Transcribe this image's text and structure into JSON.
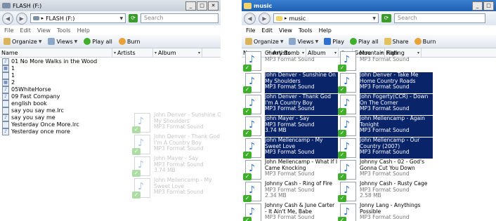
{
  "left": {
    "title": "FLASH (F:)",
    "address": "FLASH (F:)",
    "search_placeholder": "Search",
    "menu": [
      "File",
      "Edit",
      "View",
      "Tools",
      "Help"
    ],
    "toolbar": {
      "organize": "Organize",
      "views": "Views",
      "play_all": "Play all",
      "burn": "Burn"
    },
    "columns": [
      "Name",
      "Artists",
      "Album"
    ],
    "files": [
      {
        "name": "01 No More Walks in the Wood",
        "icon": "audio-file-icon"
      },
      {
        "name": "1",
        "icon": "image-file-icon"
      },
      {
        "name": "1",
        "icon": "file-icon"
      },
      {
        "name": "2",
        "icon": "image-file-icon"
      },
      {
        "name": "05WhiteHorse",
        "icon": "audio-file-icon"
      },
      {
        "name": "09 Fast Company",
        "icon": "audio-file-icon"
      },
      {
        "name": "english book",
        "icon": "document-icon"
      },
      {
        "name": "say you say me.lrc",
        "icon": "document-icon"
      },
      {
        "name": "say you say me",
        "icon": "audio-file-icon"
      },
      {
        "name": "Yesterday Once More.lrc",
        "icon": "document-icon"
      },
      {
        "name": "Yesterday once more",
        "icon": "audio-file-icon"
      }
    ],
    "ghost_tiles": [
      {
        "name": "John Denver - Sunshine On My Shoulders",
        "type": "MP3 Format Sound"
      },
      {
        "name": "John Denver - Thank God I'm A Country Boy",
        "type": "MP3 Format Sound"
      },
      {
        "name": "John Mayer - Say",
        "type": "MP3 Format Sound",
        "size": "3.74 MB"
      },
      {
        "name": "John Mellencamp - My Sweet Love",
        "type": "MP3 Format Sound"
      }
    ]
  },
  "right": {
    "title": "music",
    "address": "music",
    "search_placeholder": "Search",
    "menu": [
      "File",
      "Edit",
      "View",
      "Tools",
      "Help"
    ],
    "toolbar": {
      "organize": "Organize",
      "views": "Views",
      "play": "Play",
      "play_all": "Play all",
      "share": "Share",
      "burn": "Burn"
    },
    "columns": [
      "Name",
      "Artists",
      "Album",
      "#",
      "Genre",
      "Rating"
    ],
    "tiles": [
      {
        "name": "Cherry Bomb",
        "type": "MP3 Format Sound",
        "selected": false
      },
      {
        "name": "Mountain High",
        "type": "MP3 Format Sound",
        "selected": false
      },
      {
        "name": "John Denver - Sunshine On My Shoulders",
        "type": "MP3 Format Sound",
        "selected": true
      },
      {
        "name": "John Denver - Take Me Home Country Roads",
        "type": "MP3 Format Sound",
        "selected": true
      },
      {
        "name": "John Denver - Thank God I'm A Country Boy",
        "type": "MP3 Format Sound",
        "selected": true
      },
      {
        "name": "John Fogerty(CCR) - Down On The Corner",
        "type": "MP3 Format Sound",
        "selected": true
      },
      {
        "name": "John Mayer - Say",
        "type": "MP3 Format Sound",
        "size": "3.74 MB",
        "selected": true
      },
      {
        "name": "John Mellencamp - Again Tonight",
        "type": "MP3 Format Sound",
        "selected": true
      },
      {
        "name": "John Mellencamp - My Sweet Love",
        "type": "MP3 Format Sound",
        "selected": true
      },
      {
        "name": "John Mellencamp - Our Country (2007)",
        "type": "MP3 Format Sound",
        "selected": true
      },
      {
        "name": "John Mellencamp - What If I Came Knocking",
        "type": "MP3 Format Sound",
        "selected": false
      },
      {
        "name": "Johnny Cash - 02 - God's Gonna Cut You Down",
        "type": "MP3 Format Sound",
        "selected": false
      },
      {
        "name": "Johnny Cash - Ring of Fire",
        "type": "MP3 Format Sound",
        "size": "2.34 MB",
        "selected": false
      },
      {
        "name": "Johnny Cash - Rusty Cage",
        "type": "MP3 Format Sound",
        "size": "2.58 MB",
        "selected": false
      },
      {
        "name": "Johnny Cash & June Carter - It Ain't Me, Babe",
        "type": "MP3 Format Sound",
        "selected": false
      },
      {
        "name": "Jonny Lang - Anythings Possible",
        "type": "MP3 Format Sound",
        "selected": false
      }
    ]
  },
  "colors": {
    "selection": "#0a246a",
    "accent": "#2f6fd0",
    "titlebar_right": "#1f5fb0"
  }
}
